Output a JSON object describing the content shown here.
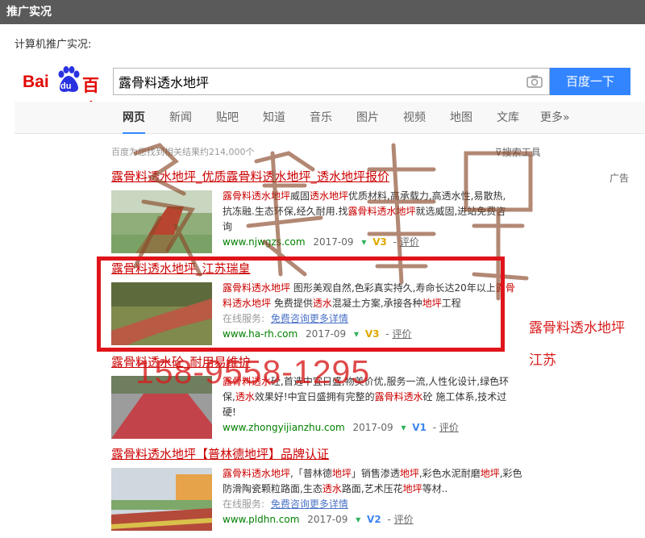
{
  "panel": {
    "title": "推广实况"
  },
  "intro": {
    "label": "计算机推广实况:"
  },
  "logo": {
    "bai": "Bai",
    "du": "du",
    "cn": "百度"
  },
  "search": {
    "query": "露骨料透水地坪",
    "button_label": "百度一下"
  },
  "tabs": [
    "网页",
    "新闻",
    "贴吧",
    "知道",
    "音乐",
    "图片",
    "视频",
    "地图",
    "文库",
    "更多»"
  ],
  "active_tab": "网页",
  "stats": {
    "result_count_text": "百度为您找到相关结果约214,000个",
    "tools_label": "搜索工具"
  },
  "ad_label": "广告",
  "results": [
    {
      "title": "露骨料透水地坪_优质露骨料透水地坪_透水地坪报价",
      "lines": [
        [
          {
            "t": "露骨料透水地坪",
            "h": true
          },
          {
            "t": "威固"
          },
          {
            "t": "透水地坪",
            "h": true
          },
          {
            "t": "优质材料,高承载力,高透水性,易散热,"
          }
        ],
        [
          {
            "t": "抗冻融.生态环保,经久耐用.找"
          },
          {
            "t": "露骨料透水地坪",
            "h": true
          },
          {
            "t": "就选威固,进站免费咨"
          }
        ],
        [
          {
            "t": "询"
          }
        ]
      ],
      "url": "www.njwgzs.com",
      "date": "2017-09",
      "v": "V3",
      "review": "评价"
    },
    {
      "title": "露骨料透水地坪_江苏瑞皇",
      "lines": [
        [
          {
            "t": "露骨料透水地坪",
            "h": true
          },
          {
            "t": " 图形美观自然,色彩真实持久,寿命长达20年以上"
          },
          {
            "t": "露骨",
            "h": true
          }
        ],
        [
          {
            "t": "料透水地坪",
            "h": true
          },
          {
            "t": " 免费提供"
          },
          {
            "t": "透水",
            "h": true
          },
          {
            "t": "混凝土方案,承接各种"
          },
          {
            "t": "地坪",
            "h": true
          },
          {
            "t": "工程"
          }
        ]
      ],
      "service_label": "在线服务:",
      "service_link": "免费咨询更多详情",
      "url": "www.ha-rh.com",
      "date": "2017-09",
      "v": "V3",
      "review": "评价"
    },
    {
      "title": "露骨料透水砼_耐用易维护",
      "lines": [
        [
          {
            "t": "露骨料透水",
            "h": true
          },
          {
            "t": "砼,首选中宜日盛,物美价优,服务一流,人性化设计,绿色环"
          }
        ],
        [
          {
            "t": "保,"
          },
          {
            "t": "透水",
            "h": true
          },
          {
            "t": "效果好!中宜日盛拥有完整的"
          },
          {
            "t": "露骨料透水",
            "h": true
          },
          {
            "t": "砼 施工体系,技术过"
          }
        ],
        [
          {
            "t": "硬!"
          }
        ]
      ],
      "url": "www.zhongyijianzhu.com",
      "date": "2017-09",
      "v": "V1",
      "review": "评价"
    },
    {
      "title": "露骨料透水地坪【普林德地坪】品牌认证",
      "lines": [
        [
          {
            "t": "露骨料透水地坪",
            "h": true
          },
          {
            "t": ",「普林德"
          },
          {
            "t": "地坪",
            "h": true
          },
          {
            "t": "」销售渗透"
          },
          {
            "t": "地坪",
            "h": true
          },
          {
            "t": ",彩色水泥耐磨"
          },
          {
            "t": "地坪",
            "h": true
          },
          {
            "t": ",彩色"
          }
        ],
        [
          {
            "t": "防滑陶瓷颗粒路面,生态"
          },
          {
            "t": "透水",
            "h": true
          },
          {
            "t": "路面,艺术压花"
          },
          {
            "t": "地坪",
            "h": true
          },
          {
            "t": "等材.."
          }
        ]
      ],
      "service_label": "在线服务:",
      "service_link": "免费咨询更多详情",
      "url": "www.pldhn.com",
      "date": "2017-09",
      "v": "V2",
      "review": "评价"
    }
  ],
  "overlay": {
    "keyword": "露骨料透水地坪",
    "region": "江苏",
    "phone": "158-9558-1295"
  },
  "colors": {
    "title_red": "#cc0000",
    "url_green": "#008000",
    "button_blue": "#3385ff",
    "highlight_frame": "#e0141a",
    "header_gray": "#5a5a5a"
  }
}
